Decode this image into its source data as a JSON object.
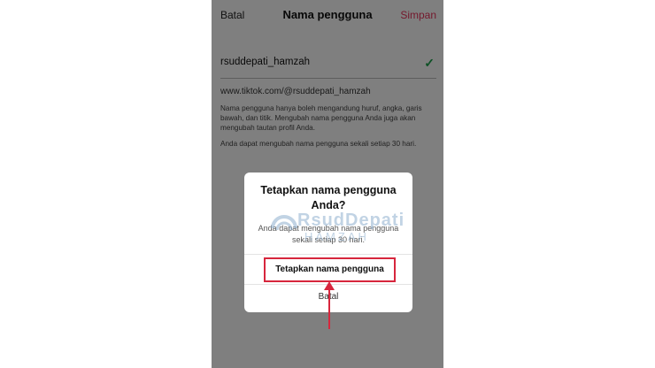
{
  "header": {
    "cancel_label": "Batal",
    "title": "Nama pengguna",
    "save_label": "Simpan"
  },
  "username_field": {
    "value": "rsuddepati_hamzah",
    "valid_icon": "check-icon"
  },
  "profile_url": "www.tiktok.com/@rsuddepati_hamzah",
  "helper_text": "Nama pengguna hanya boleh mengandung huruf, angka, garis bawah, dan titik. Mengubah nama pengguna Anda juga akan mengubah tautan profil Anda.",
  "change_limit_text": "Anda dapat mengubah nama pengguna sekali setiap 30 hari.",
  "dialog": {
    "title": "Tetapkan nama pengguna Anda?",
    "message": "Anda dapat mengubah nama pengguna sekali setiap 30 hari.",
    "confirm_label": "Tetapkan nama pengguna",
    "cancel_label": "Batal"
  },
  "watermark": {
    "line1": "RsudDepati",
    "line2": "HAMZAH"
  },
  "colors": {
    "accent": "#e8335a",
    "check": "#1aa14a",
    "highlight_box": "#d7263d"
  }
}
